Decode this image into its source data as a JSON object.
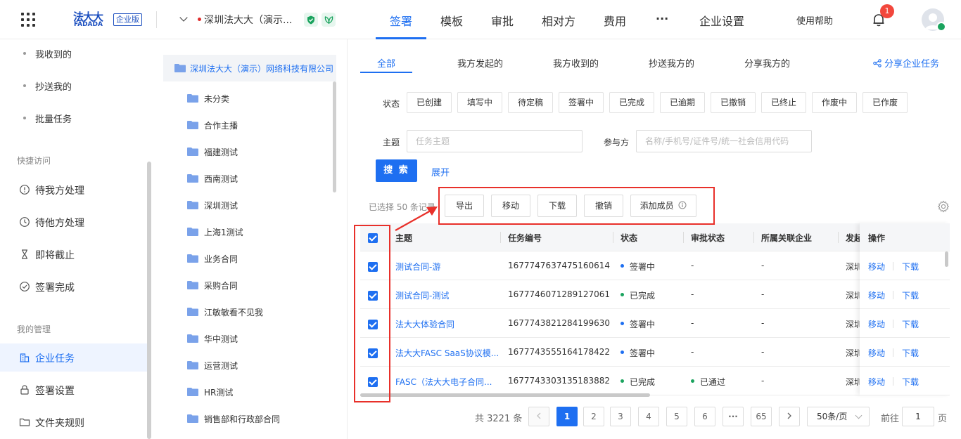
{
  "header": {
    "logo_cn": "法大大",
    "logo_en": "FADADA",
    "edition": "企业版",
    "org_name": "深圳法大大（演示...",
    "nav": [
      "签署",
      "模板",
      "审批",
      "相对方",
      "费用",
      "···",
      "企业设置"
    ],
    "help": "使用帮助",
    "notification_count": "1"
  },
  "sidebar": {
    "sub_items": [
      "我收到的",
      "抄送我的",
      "批量任务"
    ],
    "group_quick": "快捷访问",
    "quick_items": [
      "待我方处理",
      "待他方处理",
      "即将截止",
      "签署完成"
    ],
    "group_manage": "我的管理",
    "manage_items": [
      "企业任务",
      "签署设置",
      "文件夹规则"
    ]
  },
  "folders": {
    "root": "深圳法大大（演示）网络科技有限公司",
    "items": [
      "未分类",
      "合作主播",
      "福建测试",
      "西南测试",
      "深圳测试",
      "上海1测试",
      "业务合同",
      "采购合同",
      "江敏敏看不见我",
      "华中测试",
      "运营测试",
      "HR测试",
      "销售部和行政部合同"
    ]
  },
  "tabs": [
    "全部",
    "我方发起的",
    "我方收到的",
    "抄送我方的",
    "分享我方的"
  ],
  "share_link": "分享企业任务",
  "filters": {
    "status_label": "状态",
    "statuses": [
      "已创建",
      "填写中",
      "待定稿",
      "签署中",
      "已完成",
      "已逾期",
      "已撤销",
      "已终止",
      "作废中",
      "已作废"
    ],
    "subject_label": "主题",
    "subject_placeholder": "任务主题",
    "participant_label": "参与方",
    "participant_placeholder": "名称/手机号/证件号/统一社会信用代码",
    "search_button": "搜 索",
    "expand_link": "展开"
  },
  "toolbar": {
    "selected_info": "已选择 50 条记录",
    "export": "导出",
    "move": "移动",
    "download": "下载",
    "revoke": "撤销",
    "add_member": "添加成员"
  },
  "table": {
    "headers": [
      "主题",
      "任务编号",
      "状态",
      "审批状态",
      "所属关联企业",
      "发起",
      "操作"
    ],
    "rows": [
      {
        "subject": "测试合同-游",
        "number": "1677747637475160614",
        "status": "签署中",
        "status_color": "#1e6ff1",
        "approval": "-",
        "approval_color": "",
        "company": "-",
        "initiator": "深圳"
      },
      {
        "subject": "测试合同-测试",
        "number": "1677746071289127061",
        "status": "已完成",
        "status_color": "#1aa35e",
        "approval": "-",
        "approval_color": "",
        "company": "-",
        "initiator": "深圳"
      },
      {
        "subject": "法大大体验合同",
        "number": "1677743821284199630",
        "status": "签署中",
        "status_color": "#1e6ff1",
        "approval": "-",
        "approval_color": "",
        "company": "-",
        "initiator": "深圳"
      },
      {
        "subject": "法大大FASC SaaS协议模...",
        "number": "1677743555164178422",
        "status": "签署中",
        "status_color": "#1e6ff1",
        "approval": "-",
        "approval_color": "",
        "company": "-",
        "initiator": "深圳"
      },
      {
        "subject": "FASC（法大大电子合同...",
        "number": "1677743303135183882",
        "status": "已完成",
        "status_color": "#1aa35e",
        "approval": "已通过",
        "approval_color": "#1aa35e",
        "company": "-",
        "initiator": "深圳"
      }
    ],
    "op_move": "移动",
    "op_download": "下载"
  },
  "pagination": {
    "total": "共 3221 条",
    "pages": [
      "1",
      "2",
      "3",
      "4",
      "5",
      "6",
      "···",
      "65"
    ],
    "page_size": "50条/页",
    "goto_label": "前往",
    "goto_value": "1",
    "goto_suffix": "页"
  },
  "colors": {
    "accent": "#1e6ff1",
    "success": "#1aa35e",
    "annotation": "#e8302a"
  }
}
